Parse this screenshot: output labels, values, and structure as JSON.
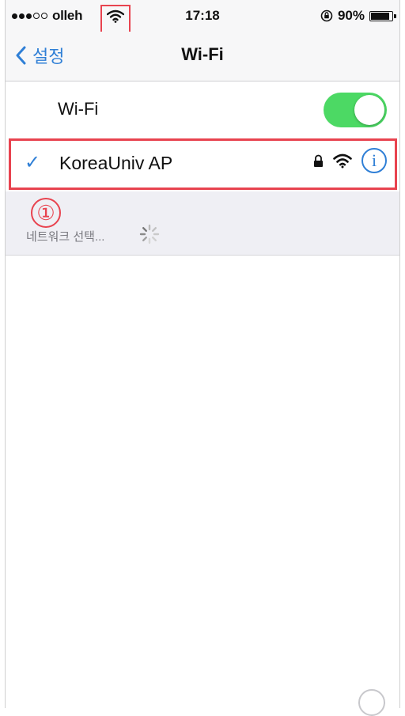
{
  "status_bar": {
    "signal": {
      "filled": 3,
      "empty": 2
    },
    "carrier": "olleh",
    "time": "17:18",
    "battery_percent": "90%",
    "battery_level": 0.9,
    "icons": [
      "signal-dots-icon",
      "wifi-icon",
      "rotation-lock-icon",
      "battery-icon"
    ]
  },
  "nav": {
    "back_label": "설정",
    "title": "Wi-Fi"
  },
  "wifi_row": {
    "label": "Wi-Fi",
    "toggle_on": true
  },
  "network": {
    "name": "KoreaUniv AP",
    "check": "✓",
    "info": "i",
    "secured": true
  },
  "annotation": {
    "step_number": "①"
  },
  "section": {
    "header": "네트워크 선택..."
  },
  "colors": {
    "accent": "#2f7fd6",
    "toggle_green": "#4cd964",
    "annotation_red": "#e8434f",
    "group_background": "#efeff4"
  }
}
